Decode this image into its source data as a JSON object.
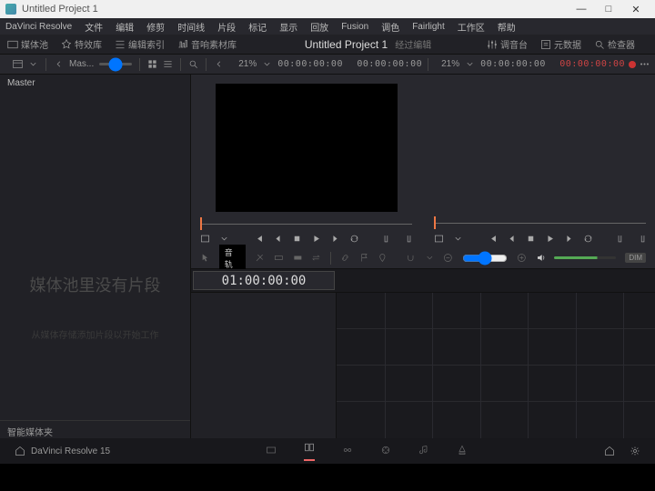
{
  "titlebar": {
    "title": "Untitled Project 1"
  },
  "menubar": {
    "items": [
      "DaVinci Resolve",
      "文件",
      "编辑",
      "修剪",
      "时间线",
      "片段",
      "标记",
      "显示",
      "回放",
      "Fusion",
      "调色",
      "Fairlight",
      "工作区",
      "帮助"
    ]
  },
  "toolbar": {
    "media": "媒体池",
    "effects": "特效库",
    "index": "编辑索引",
    "sound": "音响素材库",
    "project": "Untitled Project 1",
    "edited": "经过编辑",
    "mixer": "调音台",
    "metadata": "元数据",
    "inspector": "检查器"
  },
  "controlbar": {
    "master": "Mas...",
    "zoom1": "21%",
    "tc1a": "00:00:00:00",
    "tc1b": "00:00:00:00",
    "zoom2": "21%",
    "tc2a": "00:00:00:00",
    "tc2b": "00:00:00:00"
  },
  "sidebar": {
    "header": "Master",
    "hint1": "媒体池里没有片段",
    "hint2": "从媒体存储添加片段以开始工作",
    "footer": "智能媒体夹"
  },
  "timeline": {
    "tooltip": "音轨",
    "tc": "01:00:00:00",
    "dim": "DIM"
  },
  "bottom": {
    "brand": "DaVinci Resolve 15"
  }
}
